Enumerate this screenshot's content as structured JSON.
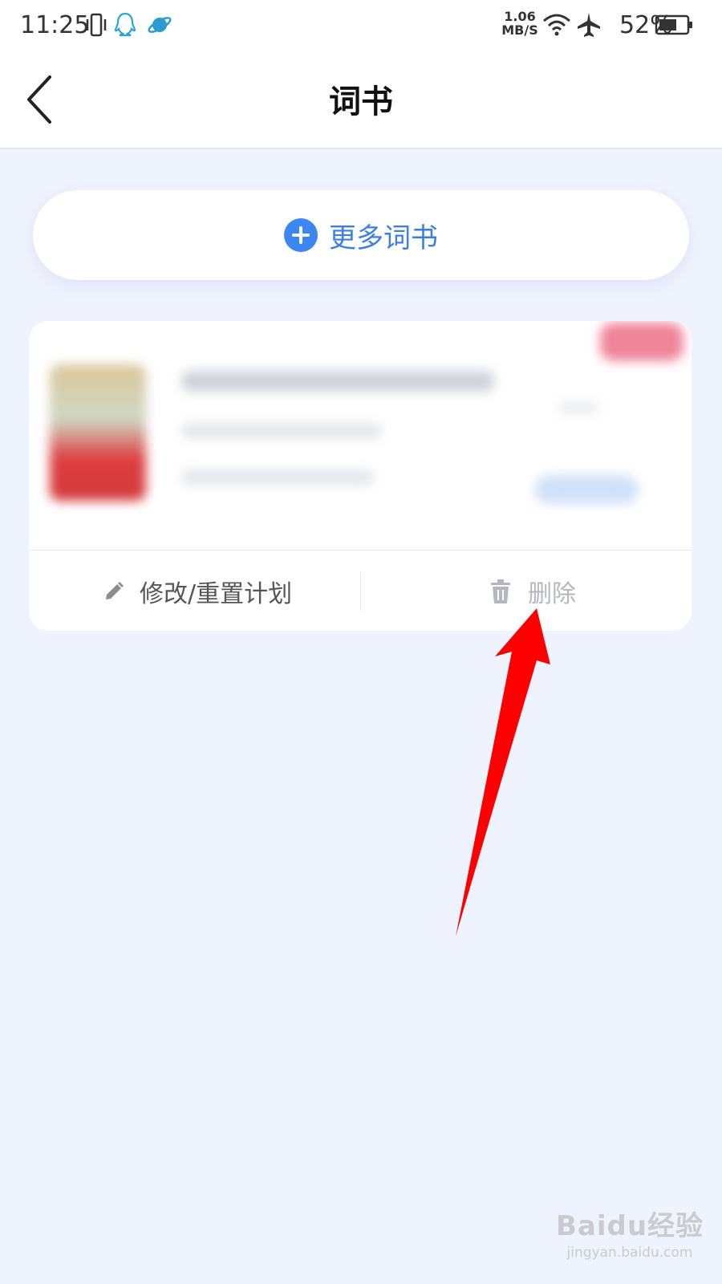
{
  "status_bar": {
    "time": "11:25",
    "speed_value": "1.06",
    "speed_unit": "MB/S",
    "battery": "52%",
    "icons": [
      "vibrate-icon",
      "qq-icon",
      "planet-app-icon",
      "wifi-icon",
      "airplane-icon",
      "battery-icon"
    ]
  },
  "header": {
    "title": "词书",
    "back_icon": "chevron-left-icon"
  },
  "more_books": {
    "label": "更多词书",
    "icon": "plus-circle-icon",
    "accent_color": "#3c87f2"
  },
  "book_card": {
    "content_blurred": true,
    "actions": {
      "edit_label": "修改/重置计划",
      "edit_icon": "pencil-icon",
      "delete_label": "删除",
      "delete_icon": "trash-icon"
    }
  },
  "annotation": {
    "type": "arrow",
    "color": "#ff0000",
    "points_to": "delete-button"
  },
  "watermark": {
    "logo_text": "Baidu经验",
    "url": "jingyan.baidu.com"
  }
}
